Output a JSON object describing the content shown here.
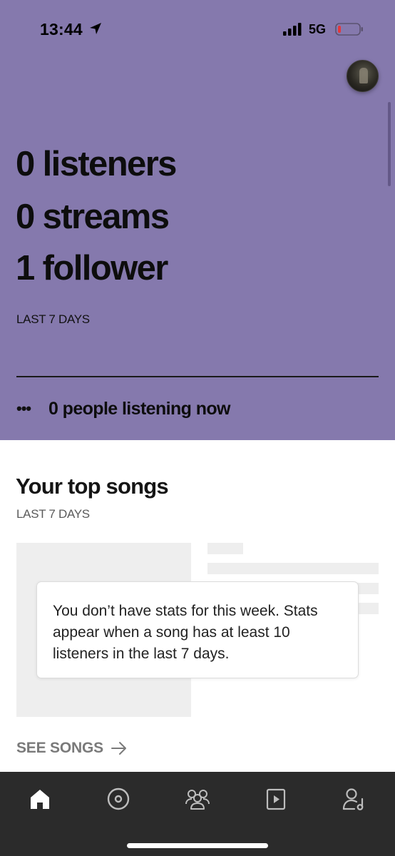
{
  "status_bar": {
    "time": "13:44",
    "network": "5G",
    "battery_color": "#e5373a"
  },
  "stats": {
    "listeners": "0 listeners",
    "streams": "0 streams",
    "followers": "1 follower",
    "period": "LAST 7 DAYS",
    "listening_now_dots": "•••",
    "listening_now": "0 people listening now"
  },
  "top_songs": {
    "title": "Your top songs",
    "period": "LAST 7 DAYS",
    "empty_message": "You don’t have stats for this week. Stats appear when a song has at least 10 listeners in the last 7 days.",
    "see_songs": "SEE SONGS"
  },
  "tab_bar": {
    "items": [
      {
        "icon": "home-icon",
        "active": true
      },
      {
        "icon": "music-disc-icon",
        "active": false
      },
      {
        "icon": "audience-icon",
        "active": false
      },
      {
        "icon": "campaign-play-icon",
        "active": false
      },
      {
        "icon": "artist-profile-icon",
        "active": false
      }
    ]
  },
  "colors": {
    "hero_background": "#8579ad",
    "tab_bar_background": "#2b2b2b",
    "placeholder_gray": "#eeeeee",
    "active_tab": "#ffffff",
    "inactive_tab": "#bdbdbd"
  }
}
